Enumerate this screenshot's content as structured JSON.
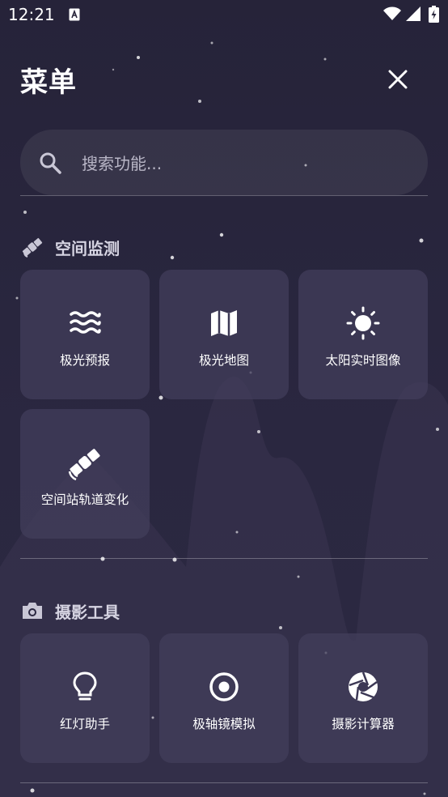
{
  "status_bar": {
    "time": "12:21"
  },
  "header": {
    "title": "菜单"
  },
  "search": {
    "placeholder": "搜索功能..."
  },
  "sections": [
    {
      "label": "空间监测",
      "icon": "satellite-icon",
      "items": [
        {
          "label": "极光预报",
          "icon": "waves-icon"
        },
        {
          "label": "极光地图",
          "icon": "map-icon"
        },
        {
          "label": "太阳实时图像",
          "icon": "sun-icon"
        },
        {
          "label": "空间站轨道变化",
          "icon": "satellite-icon"
        }
      ]
    },
    {
      "label": "摄影工具",
      "icon": "camera-icon",
      "items": [
        {
          "label": "红灯助手",
          "icon": "lightbulb-icon"
        },
        {
          "label": "极轴镜模拟",
          "icon": "target-icon"
        },
        {
          "label": "摄影计算器",
          "icon": "aperture-icon"
        }
      ]
    }
  ]
}
